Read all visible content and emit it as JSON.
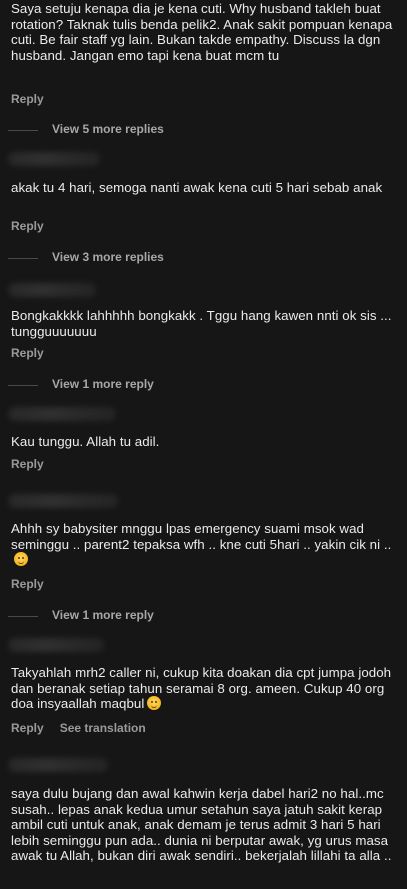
{
  "comments": [
    {
      "text": "Saya setuju kenapa dia je kena cuti. Why husband takleh buat rotation? Taknak tulis benda pelik2. Anak sakit pompuan kenapa cuti. Be fair staff yg lain. Bukan takde empathy. Discuss la dgn husband. Jangan emo tapi kena buat mcm tu",
      "reply": "Reply",
      "view_more": "View 5 more replies"
    },
    {
      "text": "akak tu 4 hari, semoga nanti awak kena cuti 5 hari sebab anak",
      "reply": "Reply",
      "view_more": "View 3 more replies"
    },
    {
      "text": "Bongkakkkk lahhhhh bongkakk . Tggu hang kawen nnti ok sis ... tungguuuuuuu",
      "reply": "Reply",
      "view_more": "View 1 more reply"
    },
    {
      "text": "Kau tunggu. Allah tu adil.",
      "reply": "Reply"
    },
    {
      "text": "Ahhh sy babysiter mnggu lpas emergency suami msok wad seminggu .. parent2 tepaksa wfh .. kne cuti 5hari .. yakin cik ni ..",
      "emoji": "pensive-face-emoji",
      "reply": "Reply",
      "view_more": "View 1 more reply"
    },
    {
      "text": "Takyahlah mrh2 caller ni, cukup kita doakan dia cpt jumpa jodoh dan beranak setiap tahun seramai 8 org. ameen. Cukup 40 org doa insyaallah maqbul",
      "emoji": "smiling-face-emoji",
      "reply": "Reply",
      "see_translation": "See translation"
    },
    {
      "text": "saya dulu bujang dan awal kahwin kerja dabel hari2 no hal..mc susah.. lepas anak kedua umur setahun saya jatuh sakit kerap ambil cuti untuk anak, anak demam je terus admit 3 hari 5 hari lebih seminggu pun ada.. dunia ni berputar awak, yg urus masa awak tu Allah, bukan diri awak sendiri.. bekerjalah lillahi ta alla .."
    }
  ]
}
